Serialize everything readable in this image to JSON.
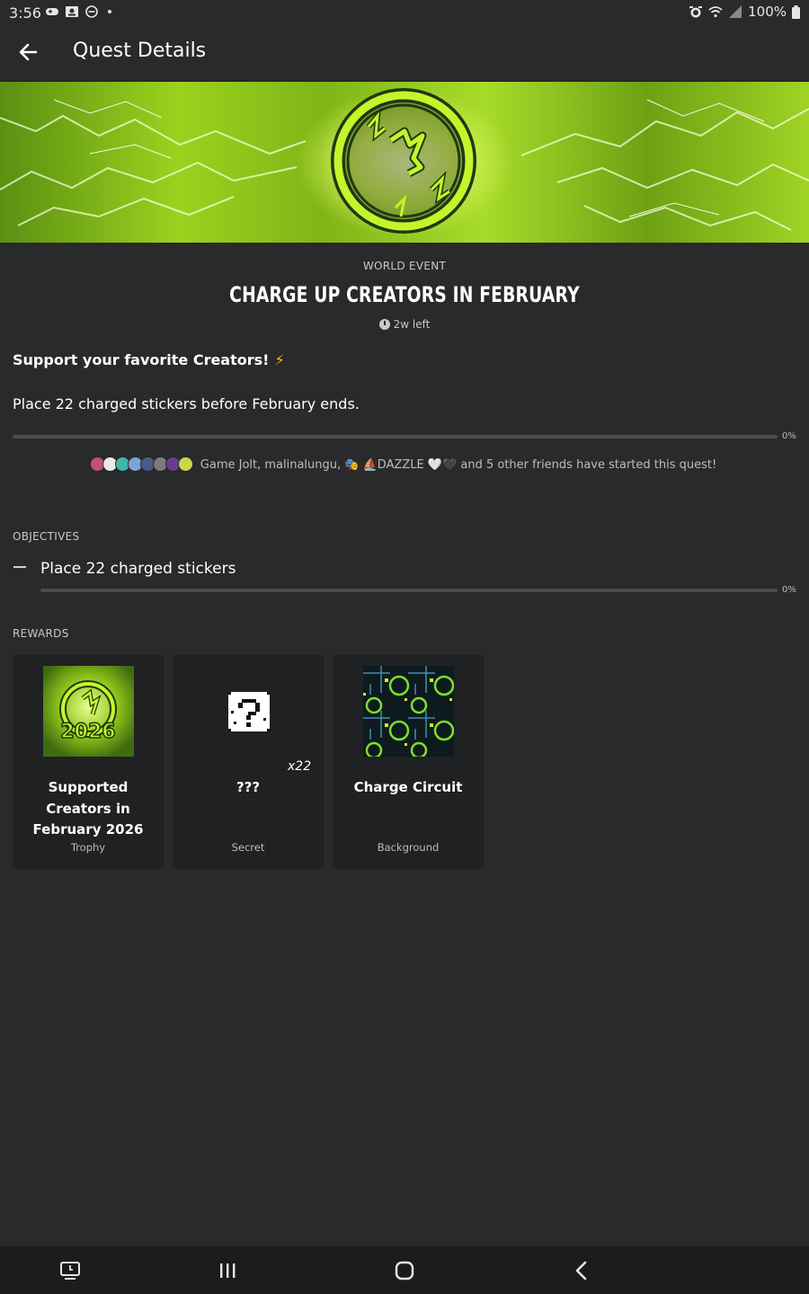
{
  "status_bar": {
    "time": "3:56",
    "battery": "100%"
  },
  "app_bar": {
    "title": "Quest Details"
  },
  "quest": {
    "kicker": "WORLD EVENT",
    "title": "CHARGE UP CREATORS IN FEBRUARY",
    "time_left": "2w left",
    "tagline": "Support your favorite Creators!",
    "tagline_emoji": "⚡",
    "description": "Place 22 charged stickers before February ends.",
    "progress": {
      "value": 0,
      "label": "0%"
    }
  },
  "friends": {
    "names": "Game Jolt, malinalungu, 🎭 ⛵DAZZLE 🤍🖤",
    "suffix": "and 5 other friends have started this quest!"
  },
  "objectives": {
    "label": "OBJECTIVES",
    "items": [
      {
        "text": "Place 22 charged stickers",
        "progress": 0,
        "progress_label": "0%"
      }
    ]
  },
  "rewards": {
    "label": "REWARDS",
    "items": [
      {
        "name": "Supported Creators in February 2026",
        "type": "Trophy",
        "art_text": "2026"
      },
      {
        "name": "???",
        "type": "Secret",
        "quantity": "x22"
      },
      {
        "name": "Charge Circuit",
        "type": "Background"
      }
    ]
  },
  "colors": {
    "accent_green": "#b8f21e",
    "background": "#282a2b",
    "card": "#1f2122"
  }
}
